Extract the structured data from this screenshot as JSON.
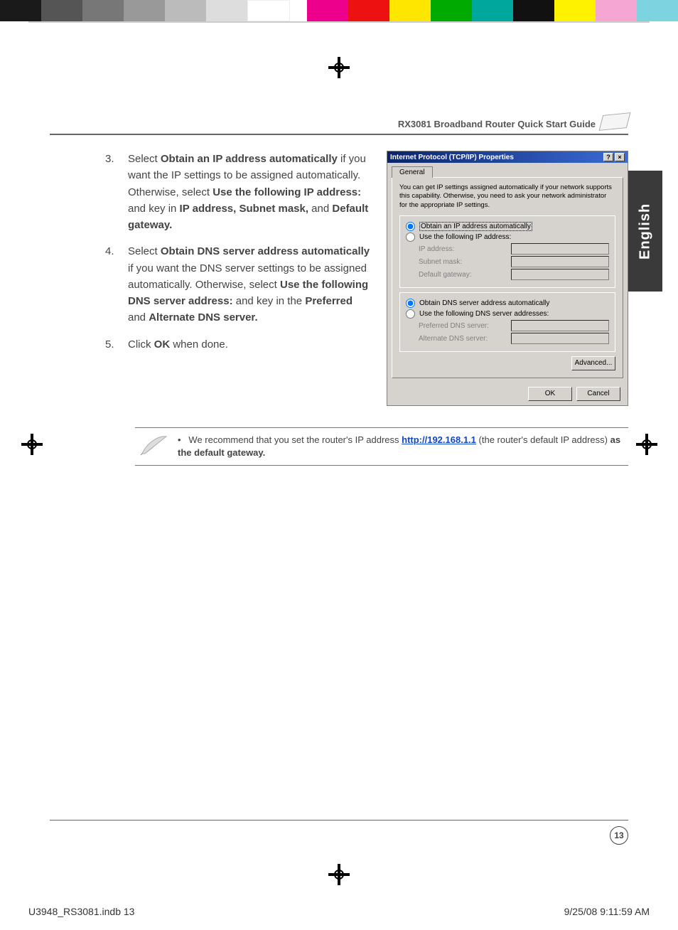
{
  "header": {
    "title": "RX3081 Broadband Router Quick Start Guide",
    "router_icon_text": ""
  },
  "language_tab": "English",
  "instructions": [
    {
      "num": "3.",
      "parts": [
        {
          "t": "Select "
        },
        {
          "t": "Obtain an IP address automatically",
          "b": true
        },
        {
          "t": " if you want the IP settings to be assigned automatically. Otherwise, select "
        },
        {
          "t": "Use the following IP address:",
          "b": true
        },
        {
          "t": " and key in "
        },
        {
          "t": "IP address, Subnet mask,",
          "b": true
        },
        {
          "t": " and "
        },
        {
          "t": "Default gateway.",
          "b": true
        }
      ]
    },
    {
      "num": "4.",
      "parts": [
        {
          "t": "Select "
        },
        {
          "t": "Obtain DNS server address automatically",
          "b": true
        },
        {
          "t": " if you want the DNS server settings to be assigned automatically. Otherwise, select "
        },
        {
          "t": "Use the following DNS server address:",
          "b": true
        },
        {
          "t": " and key in the "
        },
        {
          "t": "Preferred",
          "b": true
        },
        {
          "t": " and "
        },
        {
          "t": "Alternate DNS server.",
          "b": true
        }
      ]
    },
    {
      "num": "5.",
      "parts": [
        {
          "t": "Click "
        },
        {
          "t": "OK",
          "b": true
        },
        {
          "t": " when done."
        }
      ]
    }
  ],
  "dialog": {
    "title": "Internet Protocol (TCP/IP) Properties",
    "help_btn": "?",
    "close_btn": "×",
    "tab": "General",
    "intro": "You can get IP settings assigned automatically if your network supports this capability. Otherwise, you need to ask your network administrator for the appropriate IP settings.",
    "ip_group": {
      "radio_auto": "Obtain an IP address automatically",
      "radio_manual": "Use the following IP address:",
      "ip_label": "IP address:",
      "mask_label": "Subnet mask:",
      "gw_label": "Default gateway:",
      "selected": "auto"
    },
    "dns_group": {
      "radio_auto": "Obtain DNS server address automatically",
      "radio_manual": "Use the following DNS server addresses:",
      "pref_label": "Preferred DNS server:",
      "alt_label": "Alternate DNS server:",
      "selected": "auto"
    },
    "advanced_btn": "Advanced...",
    "ok_btn": "OK",
    "cancel_btn": "Cancel"
  },
  "note": {
    "bullet": "•",
    "pre": "We recommend that you set the router's IP address ",
    "link_text": "http://192.168.1.1",
    "post_link": " (the router's default IP address) ",
    "bold_tail": "as the default gateway."
  },
  "page_number": "13",
  "bleed": {
    "file": "U3948_RS3081.indb   13",
    "timestamp": "9/25/08   9:11:59 AM"
  }
}
